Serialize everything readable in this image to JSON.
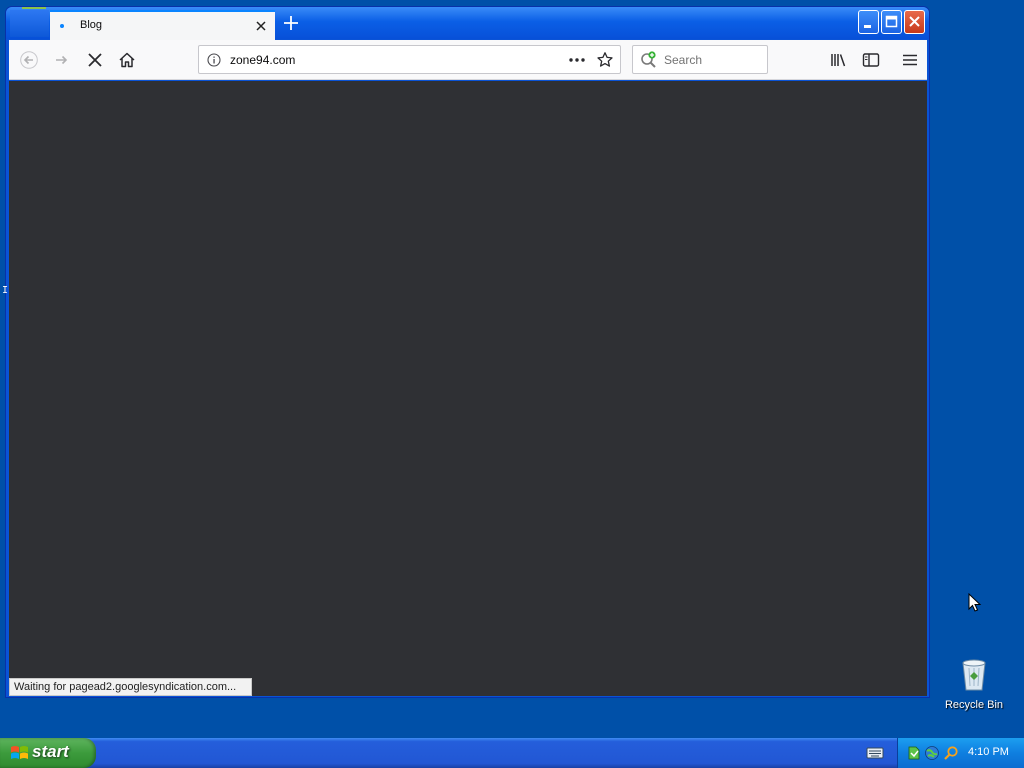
{
  "browser": {
    "tab": {
      "title": "Blog"
    },
    "address": {
      "url": "zone94.com"
    },
    "search": {
      "placeholder": "Search"
    },
    "status": "Waiting for pagead2.googlesyndication.com..."
  },
  "desktop": {
    "recycle_bin": "Recycle Bin",
    "caret": "I"
  },
  "taskbar": {
    "start_label": "start",
    "clock": "4:10 PM"
  },
  "colors": {
    "content_bg": "#2f3034",
    "desktop_bg": "#0050a8",
    "accent": "#0a84ff"
  },
  "icons": [
    "back-arrow-icon",
    "forward-arrow-icon",
    "stop-icon",
    "home-icon",
    "info-icon",
    "more-dots-icon",
    "star-icon",
    "search-icon",
    "library-icon",
    "sidebar-icon",
    "menu-icon",
    "recycle-bin-icon",
    "windows-flag-icon",
    "keyboard-icon",
    "tray-network-icon",
    "tray-globe-icon",
    "tray-search-icon"
  ]
}
